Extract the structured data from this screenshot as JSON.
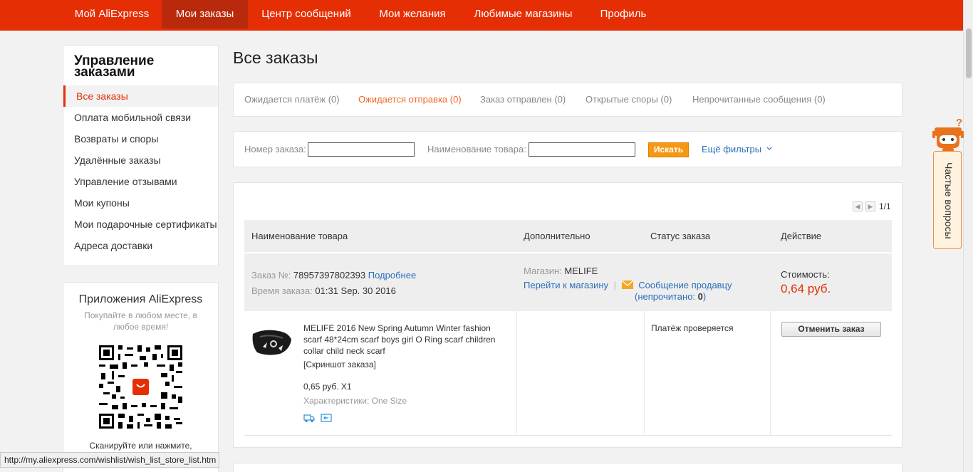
{
  "nav": {
    "items": [
      "Мой AliExpress",
      "Мои заказы",
      "Центр сообщений",
      "Мои желания",
      "Любимые магазины",
      "Профиль"
    ],
    "active": "Мои заказы"
  },
  "sidebar": {
    "heading": "Управление заказами",
    "items": [
      "Все заказы",
      "Оплата мобильной связи",
      "Возвраты и споры",
      "Удалённые заказы",
      "Управление отзывами",
      "Мои купоны",
      "Мои подарочные сертификаты",
      "Адреса доставки"
    ],
    "active": "Все заказы"
  },
  "app_promo": {
    "title": "Приложения AliExpress",
    "subtitle": "Покупайте в любом месте, в любое время!",
    "scan_text": "Сканируйте или нажмите,"
  },
  "status_bar": {
    "url": "http://my.aliexpress.com/wishlist/wish_list_store_list.htm"
  },
  "main": {
    "title": "Все заказы",
    "tabs": [
      "Ожидается платёж (0)",
      "Ожидается отправка (0)",
      "Заказ отправлен (0)",
      "Открытые споры (0)",
      "Непрочитанные сообщения (0)"
    ],
    "active_tab": "Ожидается отправка (0)"
  },
  "filters": {
    "order_number_label": "Номер заказа:",
    "order_number_value": "",
    "product_name_label": "Наименование товара:",
    "product_name_value": "",
    "search_button": "Искать",
    "more_filters": "Ещё фильтры"
  },
  "pager": {
    "text": "1/1"
  },
  "table": {
    "headers": [
      "Наименование товара",
      "Дополнительно",
      "Статус заказа",
      "Действие"
    ]
  },
  "order": {
    "number_label": "Заказ №:",
    "number": "78957397802393",
    "details_link": "Подробнее",
    "time_label": "Время заказа:",
    "time": "01:31 Sep. 30 2016",
    "store_label": "Магазин:",
    "store_name": "MELIFE",
    "goto_store": "Перейти к магазину",
    "divider": "|",
    "message_seller": "Сообщение продавцу",
    "unread_prefix": "(непрочитано: ",
    "unread_count": "0",
    "unread_suffix": ")",
    "cost_label": "Стоимость:",
    "cost": "0,64 руб.",
    "product_name": "MELIFE 2016 New Spring Autumn Winter fashion scarf 48*24cm scarf boys girl O Ring scarf children collar child neck scarf",
    "snapshot": "[Скриншот заказа]",
    "price_qty": "0,65 руб. X1",
    "props_label": "Характеристики:",
    "props_value": "One Size",
    "status": "Платёж проверяется",
    "cancel_button": "Отменить заказ"
  },
  "faq": {
    "label": "Частые вопросы"
  },
  "colors": {
    "brand": "#e62e04",
    "active_tab": "#f06628",
    "link": "#2a6ebb",
    "search_button": "#f69814"
  },
  "icons": [
    "robot-help-icon",
    "shipping-icon",
    "return-icon",
    "envelope-icon",
    "chevron-down-icon",
    "pager-prev-icon",
    "pager-next-icon",
    "qr-code",
    "aliexpress-logo"
  ]
}
